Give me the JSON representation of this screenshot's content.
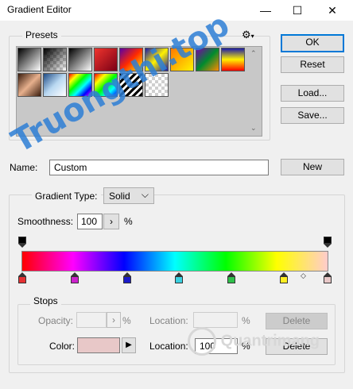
{
  "window": {
    "title": "Gradient Editor",
    "minimize_glyph": "—",
    "maximize_glyph": "☐",
    "close_glyph": "✕"
  },
  "presets": {
    "label": "Presets",
    "gear_glyph": "⚙",
    "swatches": [
      {
        "bg": "linear-gradient(135deg,#000,#fff)"
      },
      {
        "bg": "checker-black"
      },
      {
        "bg": "linear-gradient(135deg,#000,#fff)"
      },
      {
        "bg": "linear-gradient(135deg,#f0342d,#7a0016)"
      },
      {
        "bg": "linear-gradient(135deg,#5a00a5,#ff2a00,#ffef00)"
      },
      {
        "bg": "linear-gradient(135deg,#1a1aa8,#fff200,#1a1aa8)"
      },
      {
        "bg": "linear-gradient(135deg,#ff7a00,#fff200)"
      },
      {
        "bg": "linear-gradient(135deg,#7a00a8,#008b2e,#ff8a00)"
      },
      {
        "bg": "linear-gradient(180deg,#1a1aa8,#fff200,#ff0000)"
      },
      {
        "bg": "linear-gradient(135deg,#3b1d0e,#e7b08d,#3b1d0e)"
      },
      {
        "bg": "linear-gradient(135deg,#1f4c86,#b9d8f1,#fff)"
      },
      {
        "bg": "linear-gradient(135deg,#ff0000,#ffff00,#00ff00,#00ffff,#0000ff,#ff00ff)"
      },
      {
        "bg": "linear-gradient(135deg,#ff0000,#ffff00,#00ff00,#00ffff,#0000ff)"
      },
      {
        "bg": "repeating-linear-gradient(135deg,#000 0 3px,#fff 3px 6px)"
      },
      {
        "bg": "checker"
      }
    ]
  },
  "buttons": {
    "ok": "OK",
    "reset": "Reset",
    "load": "Load...",
    "save": "Save...",
    "new": "New"
  },
  "name_field": {
    "label": "Name:",
    "value": "Custom"
  },
  "gradient_type": {
    "label": "Gradient Type:",
    "value": "Solid",
    "chevron": "⌵"
  },
  "smoothness": {
    "label": "Smoothness:",
    "value": "100",
    "unit": "%",
    "arrow": "›"
  },
  "gradient_bar": {
    "colors": [
      "#ff0000",
      "#ff00ff",
      "#0000ff",
      "#00ffff",
      "#00ff00",
      "#ffff00",
      "#ffcccc"
    ]
  },
  "color_stops": [
    "#e53032",
    "#cc22cc",
    "#1a1ac8",
    "#3ad0e0",
    "#2ec04a",
    "#ffee22",
    "#e8c8c8"
  ],
  "stops": {
    "label": "Stops",
    "opacity_label": "Opacity:",
    "opacity_unit": "%",
    "opacity_location_label": "Location:",
    "opacity_location_unit": "%",
    "opacity_delete": "Delete",
    "color_label": "Color:",
    "color_value": "#e8c8c8",
    "color_arrow": "▶",
    "color_location_label": "Location:",
    "color_location_value": "100",
    "color_location_unit": "%",
    "color_delete": "Delete"
  },
  "watermark": {
    "text": "Truongthi.top",
    "brand": "Quantrimang"
  }
}
